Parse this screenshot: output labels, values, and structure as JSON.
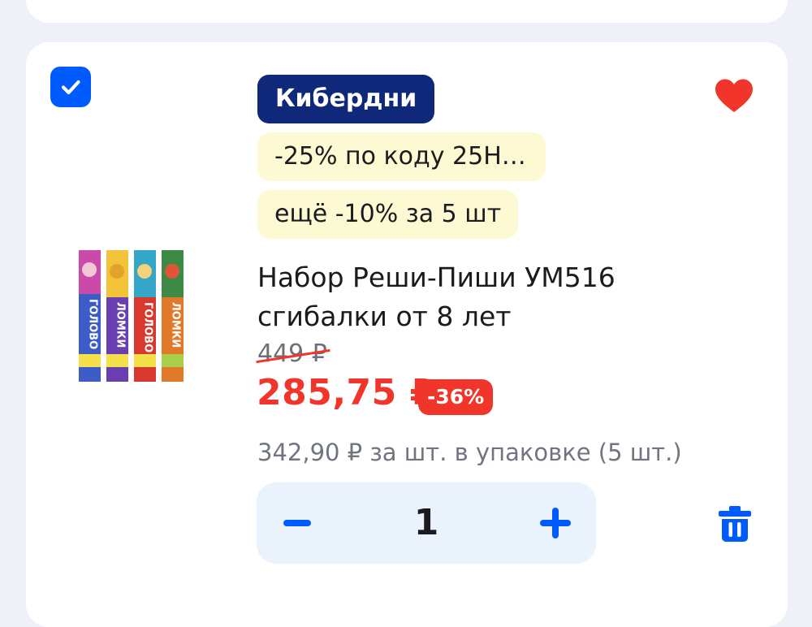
{
  "product": {
    "sale_badge": "Кибердни",
    "promo_code": "-25% по коду 25Н…",
    "promo_bulk": "ещё -10% за 5 шт",
    "title": "Набор Реши-Пиши УМ516 сгибалки от 8 лет",
    "old_price": "449 ₽",
    "price": "285,75 ₽",
    "discount": "-36%",
    "unit_price": "342,90 ₽ за шт. в упаковке (5 шт.)",
    "quantity": "1",
    "selected": true,
    "favorited": true
  },
  "image": {
    "packs": [
      {
        "text": "ГОЛО-ВО-ЛОМ-КИ",
        "color": "#3d5cc8"
      },
      {
        "text": "ГОЛО-ВО-ЛОМ-КИ",
        "color": "#6a3fb0"
      },
      {
        "text": "ГОЛО-ВО-ЛОМ-КИ",
        "color": "#d8392f"
      },
      {
        "text": "ГОЛО-ВО-ЛОМ-КИ",
        "color": "#e07a2a"
      }
    ]
  },
  "colors": {
    "accent_blue": "#005bff",
    "sale_red": "#f1352b",
    "badge_navy": "#10287a",
    "promo_yellow": "#fdf9d2"
  },
  "icons": {
    "checkbox": "check-icon",
    "favorite": "heart-icon",
    "decrement": "minus-icon",
    "increment": "plus-icon",
    "delete": "trash-icon"
  }
}
